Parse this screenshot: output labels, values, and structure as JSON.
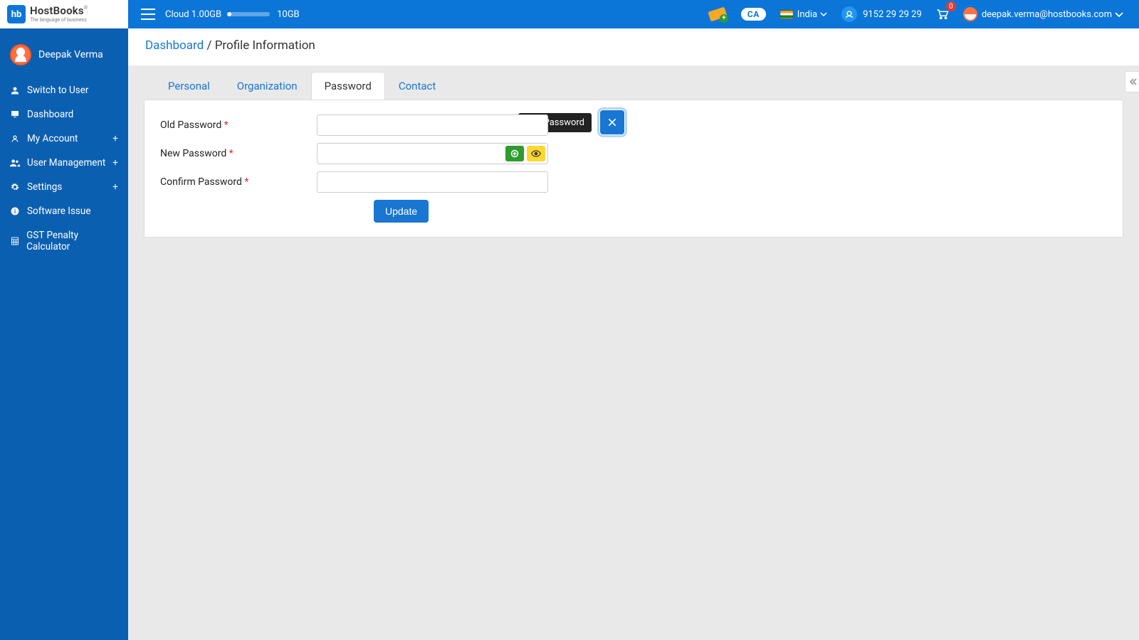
{
  "header": {
    "brand": "HostBooks",
    "brand_badge": "hb",
    "tagline": "The language of business",
    "cloud_prefix": "Cloud",
    "cloud_used": "1.00GB",
    "cloud_total": "10GB",
    "country": "India",
    "support_phone": "9152 29 29 29",
    "cart_count": "0",
    "user_email": "deepak.verma@hostbooks.com",
    "ca_label": "CA"
  },
  "sidebar": {
    "profile_name": "Deepak Verma",
    "items": [
      {
        "icon": "user",
        "label": "Switch to User",
        "expand": false
      },
      {
        "icon": "dashboard",
        "label": "Dashboard",
        "expand": false
      },
      {
        "icon": "account",
        "label": "My Account",
        "expand": true
      },
      {
        "icon": "users",
        "label": "User Management",
        "expand": true
      },
      {
        "icon": "gear",
        "label": "Settings",
        "expand": true
      },
      {
        "icon": "info",
        "label": "Software Issue",
        "expand": false
      },
      {
        "icon": "calc",
        "label": "GST Penalty Calculator",
        "expand": false
      }
    ]
  },
  "breadcrumb": {
    "root": "Dashboard",
    "current": "Profile Information"
  },
  "tabs": [
    {
      "label": "Personal",
      "active": false
    },
    {
      "label": "Organization",
      "active": false
    },
    {
      "label": "Password",
      "active": true
    },
    {
      "label": "Contact",
      "active": false
    }
  ],
  "panel": {
    "tooltip": "Edit Password",
    "fields": {
      "old_label": "Old Password",
      "new_label": "New Password",
      "confirm_label": "Confirm Password"
    },
    "asterisk": "*",
    "update_button": "Update"
  }
}
